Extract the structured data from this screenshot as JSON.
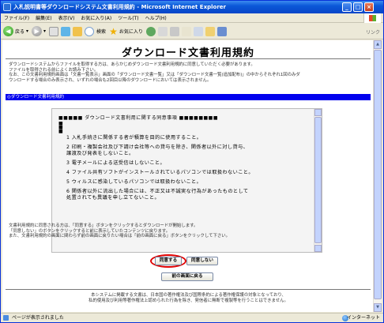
{
  "window": {
    "title": "入札説明書等ダウンロードシステム文書利用規約 - Microsoft Internet Explorer"
  },
  "menubar": {
    "items": [
      "ファイル(F)",
      "編集(E)",
      "表示(V)",
      "お気に入り(A)",
      "ツール(T)",
      "ヘルプ(H)"
    ]
  },
  "toolbar": {
    "back_label": "戻る",
    "search_label": "検索",
    "favorites_label": "お気に入り",
    "links_label": "リンク"
  },
  "page": {
    "title": "ダウンロード文書利用規約",
    "intro": "ダウンロードシステムからファイルを取得する方は、あらかじめダウンロード文書利用規約に同意していただく必要があります。\nファイルを取得される前によくお読み下さい。\nなお、この文書利用規約画面は「文書一覧表示」画面の「ダウンロード文書一覧」又は「ダウンロード文書一覧(追加配布)」の中からそれぞれ1回のみダ\nウンロードする場合のみ表示され、いずれの場合も2回目以降のダウンロードにおいては表示されません。",
    "section_label": "◎ダウンロード文書利用規約",
    "notes": "文書利用規約に同意される方は、「同意する」ボタンをクリックするとダウンロードが開始します。\n「同意しない」のボタンをクリックすると前に表示していたコンテンツに戻ります。\nまた、文書利用規約の画面に関わらず前の画面に戻りたい場合は「前の画面に戻る」ボタンをクリックして下さい。",
    "footer": "本システムに掲載する文書は、日本国の著作権法及び国際条約による著作権保護の対象となっており、\n私的使用及び利用等著作権法上認められた行為を除き、発信者に無断で複製等を行うことはできません。"
  },
  "terms": {
    "header": "■■■■■  ダウンロード文書利用に関する同意事項  ■■■■■■■■",
    "marks": "■\n■\n■",
    "items": [
      "1 入札手続きに関係する者が積算を目的に使用すること。",
      "2 印刷・複製会社及び下請け会社等への貸与を除き、関係者以外に対し貸与、\n  譲渡及び発表をしないこと。",
      "3 電子メールによる送受信はしないこと。",
      "4 ファイル共有ソフトがインストールされているパソコンでは取扱わないこと。",
      "5 ウィルスに感染しているパソコンでは取扱わないこと。",
      "6 関係者以外に流出した場合には、不正又は不誠実な行為があったものとして\n  処置されても異議を申し立てないこと。"
    ]
  },
  "buttons": {
    "agree": "同意する",
    "disagree": "同意しない",
    "back": "前の画面に戻る"
  },
  "statusbar": {
    "text": "ページが表示されました",
    "zone": "インターネット"
  }
}
